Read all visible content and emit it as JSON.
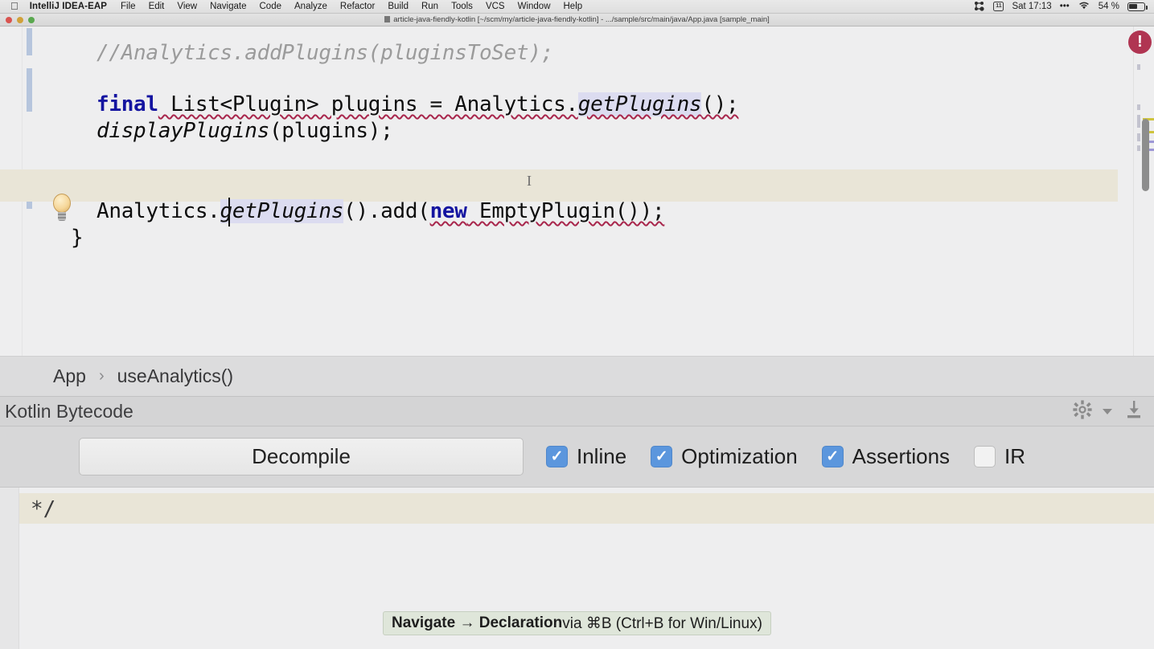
{
  "menubar": {
    "apple_icon": "apple-logo-icon",
    "app_name": "IntelliJ IDEA-EAP",
    "items": [
      "File",
      "Edit",
      "View",
      "Navigate",
      "Code",
      "Analyze",
      "Refactor",
      "Build",
      "Run",
      "Tools",
      "VCS",
      "Window",
      "Help"
    ],
    "status": {
      "bluetooth_icon": "bluetooth-icon",
      "calendar_icon_day": "11",
      "clock": "Sat 17:13",
      "ellipsis": "•••",
      "wifi_icon": "wifi-icon",
      "battery_percent": "54 %"
    }
  },
  "window": {
    "title": "article-java-fiendly-kotlin [~/scm/my/article-java-fiendly-kotlin] - .../sample/src/main/java/App.java [sample_main]",
    "traffic_lights": [
      "close",
      "minimize",
      "zoom"
    ]
  },
  "editor": {
    "lines": [
      {
        "text": "//Analytics.addPlugins(pluginsToSet);",
        "kind": "comment"
      },
      {
        "text": "final List<Plugin> plugins = Analytics.getPlugins();",
        "kind": "code"
      },
      {
        "text": "displayPlugins(plugins);",
        "kind": "code"
      },
      {
        "text": "Analytics.getPlugins().add(new EmptyPlugin());",
        "kind": "code"
      },
      {
        "text": "}",
        "kind": "code"
      }
    ],
    "tokens": {
      "final": "final",
      "list_decl": " List<Plugin> plugins = Analytics.",
      "get_plugins": "getPlugins",
      "call_end": "();",
      "display_plugins": "displayPlugins",
      "display_args": "(plugins);",
      "analytics": "Analytics.",
      "add_open": "().add(",
      "new_kw": "new",
      "empty_plugin": " EmptyPlugin());",
      "closing_brace": "}"
    },
    "gutter_icon": "lightbulb-intention-icon",
    "error_badge": "!",
    "colors": {
      "keyword": "#1414a0",
      "comment": "#9b9b9b",
      "error_squiggle": "#a8264c",
      "identifier_highlight": "#dcdcf0",
      "caret_line": "#e9e5d7",
      "vcs_change_marker": "#b6c5dd",
      "error_badge": "#b03552"
    }
  },
  "breadcrumb": {
    "items": [
      "App",
      "useAnalytics()"
    ],
    "separator": "›"
  },
  "tool_window": {
    "title": "Kotlin Bytecode",
    "settings_icon": "gear-icon",
    "dropdown_icon": "chevron-down-icon",
    "hide_icon": "hide-tool-window-icon",
    "decompile_label": "Decompile",
    "options": [
      {
        "label": "Inline",
        "checked": true
      },
      {
        "label": "Optimization",
        "checked": true
      },
      {
        "label": "Assertions",
        "checked": true
      },
      {
        "label": "IR",
        "checked": false
      }
    ],
    "checkbox_check_glyph": "✓",
    "checkbox_on_color": "#5b96dd"
  },
  "bytecode_panel": {
    "text": "*/"
  },
  "tooltip": {
    "bold_part": "Navigate → Declaration",
    "rest_part": " via ⌘B (Ctrl+B for Win/Linux)"
  }
}
